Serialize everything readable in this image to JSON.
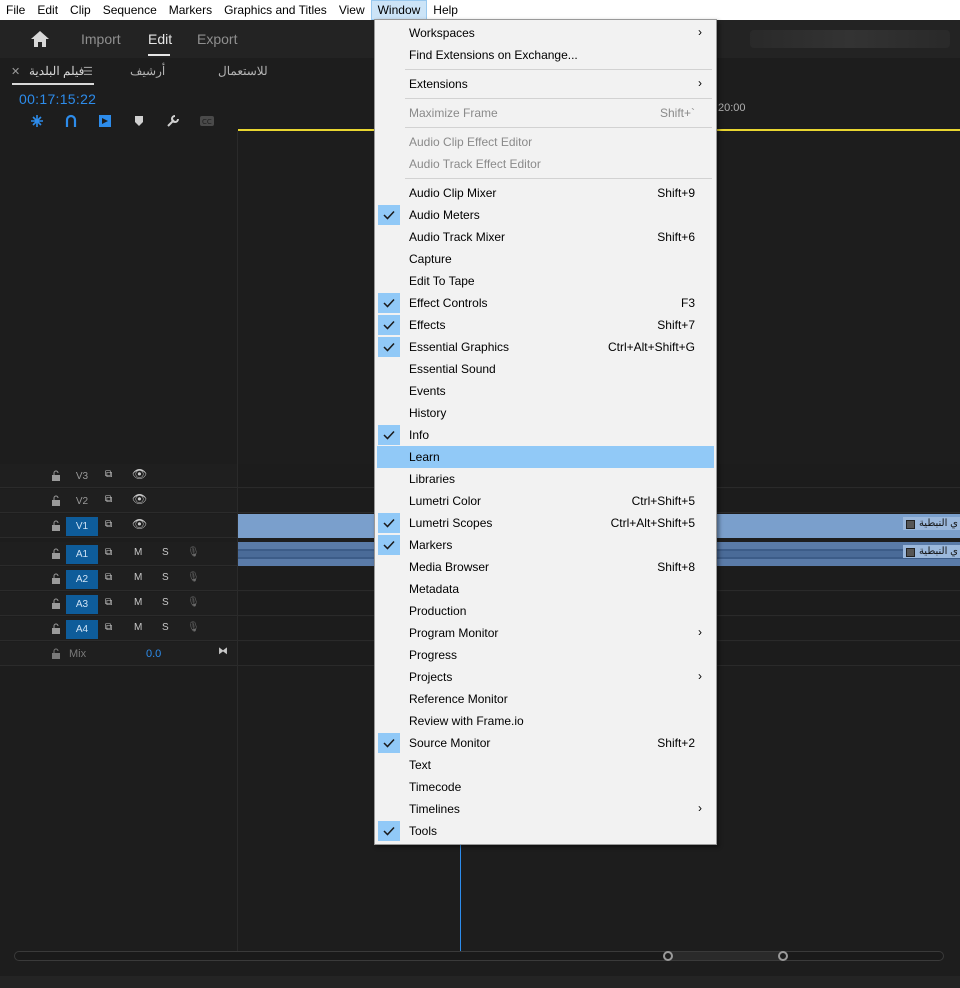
{
  "menubar": {
    "items": [
      "File",
      "Edit",
      "Clip",
      "Sequence",
      "Markers",
      "Graphics and Titles",
      "View",
      "Window",
      "Help"
    ],
    "active": "Window"
  },
  "header": {
    "nav": [
      "Import",
      "Edit",
      "Export"
    ],
    "active_nav": "Edit"
  },
  "timeline": {
    "tabs": [
      "فيلم البلدية",
      "أرشيف",
      "للاستعمال"
    ],
    "timecode": "00:17:15:22",
    "ruler_time": "20:00",
    "clip_label_v": "ي النبطية",
    "clip_label_a": "ي النبطية",
    "video_tracks": [
      "V3",
      "V2",
      "V1"
    ],
    "audio_tracks": [
      "A1",
      "A2",
      "A3",
      "A4"
    ],
    "mute_label": "M",
    "solo_label": "S",
    "mix_label": "Mix",
    "mix_value": "0.0"
  },
  "window_menu": {
    "items": [
      {
        "label": "Workspaces",
        "submenu": true
      },
      {
        "label": "Find Extensions on Exchange..."
      },
      {
        "separator": true
      },
      {
        "label": "Extensions",
        "submenu": true
      },
      {
        "separator": true
      },
      {
        "label": "Maximize Frame",
        "shortcut": "Shift+`",
        "disabled": true
      },
      {
        "separator": true
      },
      {
        "label": "Audio Clip Effect Editor",
        "disabled": true
      },
      {
        "label": "Audio Track Effect Editor",
        "disabled": true
      },
      {
        "separator": true
      },
      {
        "label": "Audio Clip Mixer",
        "shortcut": "Shift+9"
      },
      {
        "label": "Audio Meters",
        "checked": true
      },
      {
        "label": "Audio Track Mixer",
        "shortcut": "Shift+6"
      },
      {
        "label": "Capture"
      },
      {
        "label": "Edit To Tape"
      },
      {
        "label": "Effect Controls",
        "shortcut": "F3",
        "checked": true
      },
      {
        "label": "Effects",
        "shortcut": "Shift+7",
        "checked": true
      },
      {
        "label": "Essential Graphics",
        "shortcut": "Ctrl+Alt+Shift+G",
        "checked": true
      },
      {
        "label": "Essential Sound"
      },
      {
        "label": "Events"
      },
      {
        "label": "History"
      },
      {
        "label": "Info",
        "checked": true
      },
      {
        "label": "Learn",
        "highlighted": true
      },
      {
        "label": "Libraries"
      },
      {
        "label": "Lumetri Color",
        "shortcut": "Ctrl+Shift+5"
      },
      {
        "label": "Lumetri Scopes",
        "shortcut": "Ctrl+Alt+Shift+5",
        "checked": true
      },
      {
        "label": "Markers",
        "checked": true
      },
      {
        "label": "Media Browser",
        "shortcut": "Shift+8"
      },
      {
        "label": "Metadata"
      },
      {
        "label": "Production"
      },
      {
        "label": "Program Monitor",
        "submenu": true
      },
      {
        "label": "Progress"
      },
      {
        "label": "Projects",
        "submenu": true
      },
      {
        "label": "Reference Monitor"
      },
      {
        "label": "Review with Frame.io"
      },
      {
        "label": "Source Monitor",
        "shortcut": "Shift+2",
        "checked": true
      },
      {
        "label": "Text"
      },
      {
        "label": "Timecode"
      },
      {
        "label": "Timelines",
        "submenu": true
      },
      {
        "label": "Tools",
        "checked": true
      }
    ]
  },
  "colors": {
    "accent_blue": "#2d8ceb",
    "menu_highlight": "#91c9f7",
    "track_target": "#0e5c9a",
    "playhead_bar": "#e8d530"
  }
}
